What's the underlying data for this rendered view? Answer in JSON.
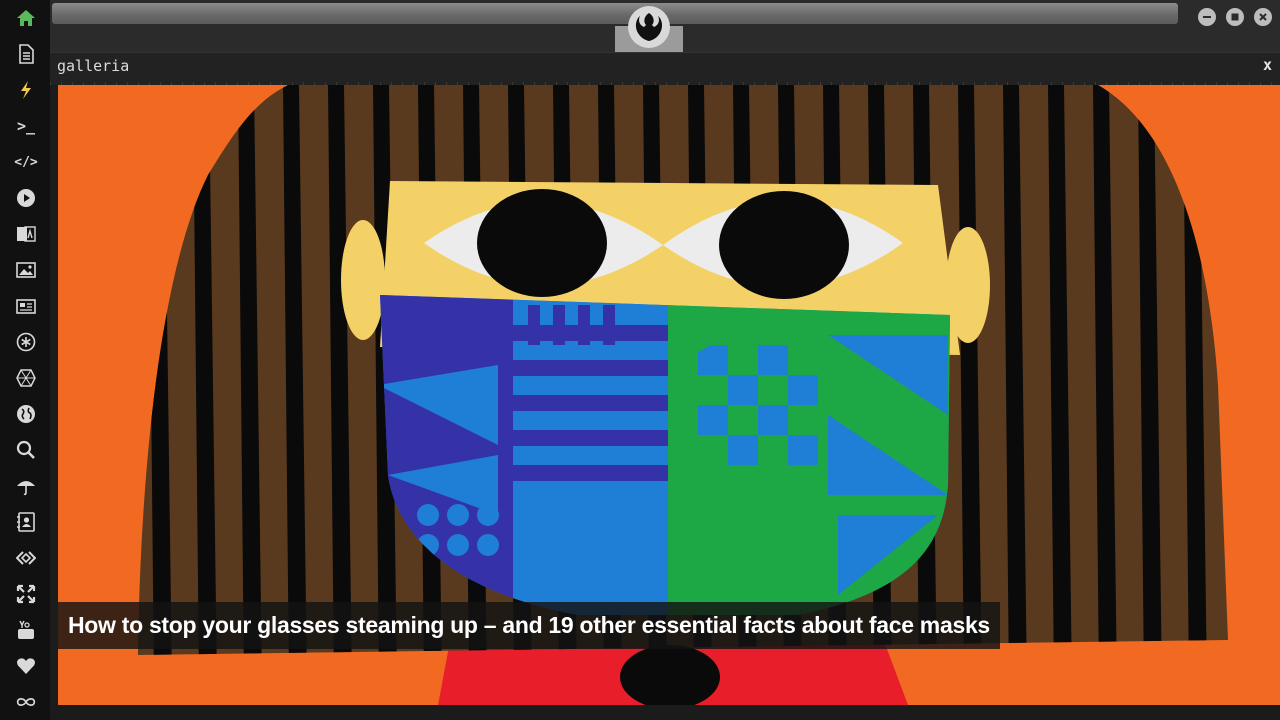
{
  "app": {
    "panel_title": "galleria",
    "close_label": "x",
    "accent_color": "#5cb85c"
  },
  "sidebar": {
    "items": [
      {
        "name": "home-icon",
        "active": true
      },
      {
        "name": "document-icon"
      },
      {
        "name": "lightning-icon"
      },
      {
        "name": "terminal-icon",
        "glyph": ">_"
      },
      {
        "name": "code-icon",
        "glyph": "</>"
      },
      {
        "name": "play-icon"
      },
      {
        "name": "translate-icon"
      },
      {
        "name": "image-icon"
      },
      {
        "name": "newspaper-icon"
      },
      {
        "name": "asterisk-icon"
      },
      {
        "name": "hexagon-icon"
      },
      {
        "name": "globe-icon"
      },
      {
        "name": "search-icon"
      },
      {
        "name": "umbrella-icon"
      },
      {
        "name": "contacts-icon"
      },
      {
        "name": "diamond-code-icon"
      },
      {
        "name": "expand-icon"
      },
      {
        "name": "youtube-icon"
      },
      {
        "name": "heart-icon"
      },
      {
        "name": "infinity-icon"
      }
    ]
  },
  "window_controls": [
    "minimize-icon",
    "maximize-icon",
    "close-icon"
  ],
  "gallery": {
    "caption": "How to stop your glasses steaming up – and 19 other essential facts about face masks",
    "colors": {
      "background": "#f26a22",
      "hair": "#5a3a1e",
      "stripe": "#0a0a0a",
      "skin": "#f4d166",
      "mask_blue": "#1f7fd6",
      "mask_navy": "#3432a6",
      "mask_green": "#1da845",
      "shirt": "#e81f2a"
    }
  }
}
